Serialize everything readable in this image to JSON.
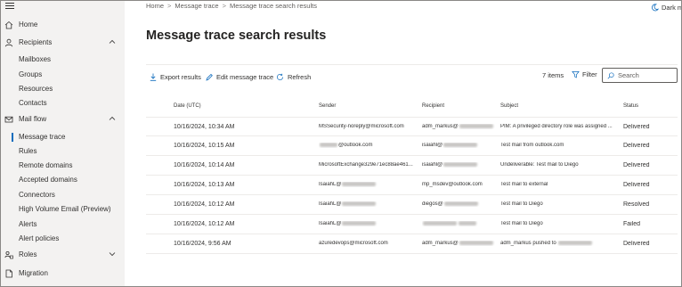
{
  "sidebar": {
    "items": [
      {
        "label": "Home",
        "icon": "home-icon",
        "chevron": false,
        "indent": false
      },
      {
        "label": "Recipients",
        "icon": "person-icon",
        "chevron": true,
        "indent": false
      },
      {
        "label": "Mailboxes",
        "indent": true
      },
      {
        "label": "Groups",
        "indent": true
      },
      {
        "label": "Resources",
        "indent": true
      },
      {
        "label": "Contacts",
        "indent": true
      },
      {
        "label": "Mail flow",
        "icon": "mail-icon",
        "chevron": true,
        "indent": false
      },
      {
        "label": "Message trace",
        "indent": true,
        "active": true
      },
      {
        "label": "Rules",
        "indent": true
      },
      {
        "label": "Remote domains",
        "indent": true
      },
      {
        "label": "Accepted domains",
        "indent": true
      },
      {
        "label": "Connectors",
        "indent": true
      },
      {
        "label": "High Volume Email (Preview)",
        "indent": true
      },
      {
        "label": "Alerts",
        "indent": true
      },
      {
        "label": "Alert policies",
        "indent": true
      },
      {
        "label": "Roles",
        "icon": "roles-icon",
        "chevron": true,
        "indent": false
      },
      {
        "label": "Migration",
        "icon": "migration-icon",
        "chevron": false,
        "indent": false
      }
    ]
  },
  "breadcrumb": {
    "home": "Home",
    "trace": "Message trace",
    "current": "Message trace search results"
  },
  "header": {
    "dark_mode": "Dark m"
  },
  "page": {
    "title": "Message trace search results"
  },
  "toolbar": {
    "export": "Export results",
    "edit": "Edit message trace",
    "refresh": "Refresh",
    "count": "7 items",
    "filter": "Filter",
    "search_placeholder": "Search"
  },
  "table": {
    "columns": {
      "date": "Date (UTC)",
      "sender": "Sender",
      "recipient": "Recipient",
      "subject": "Subject",
      "status": "Status"
    },
    "rows": [
      {
        "date": "10/16/2024, 10:34 AM",
        "sender": "MSSecurity-noreply@microsoft.com",
        "recipient": "adm_markus@",
        "subject": "PIM: A privileged directory role was assigned ...",
        "status": "Delivered"
      },
      {
        "date": "10/16/2024, 10:15 AM",
        "sender": "@outlook.com",
        "recipient": "isaiahl@",
        "subject": "Test mail from outlook.com",
        "status": "Delivered"
      },
      {
        "date": "10/16/2024, 10:14 AM",
        "sender": "MicrosoftExchange329e71ec88ae461...",
        "recipient": "isaiahl@",
        "subject": "Undeliverable: Test mail to Diego",
        "status": "Delivered"
      },
      {
        "date": "10/16/2024, 10:13 AM",
        "sender": "IsaiahL@",
        "recipient": "mp_msdev@outlook.com",
        "subject": "Test mail to external",
        "status": "Delivered"
      },
      {
        "date": "10/16/2024, 10:12 AM",
        "sender": "IsaiahL@",
        "recipient": "diegos@",
        "subject": "Test mail to Diego",
        "status": "Resolved"
      },
      {
        "date": "10/16/2024, 10:12 AM",
        "sender": "IsaiahL@",
        "recipient": "",
        "subject": "Test mail to Diego",
        "status": "Failed"
      },
      {
        "date": "10/16/2024, 9:56 AM",
        "sender": "azuredevops@microsoft.com",
        "recipient": "adm_markus@",
        "subject": "adm_markus pushed to",
        "status": "Delivered"
      }
    ]
  },
  "colors": {
    "accent": "#0f6cbd",
    "sidebar_bg": "#f3f2f1"
  }
}
